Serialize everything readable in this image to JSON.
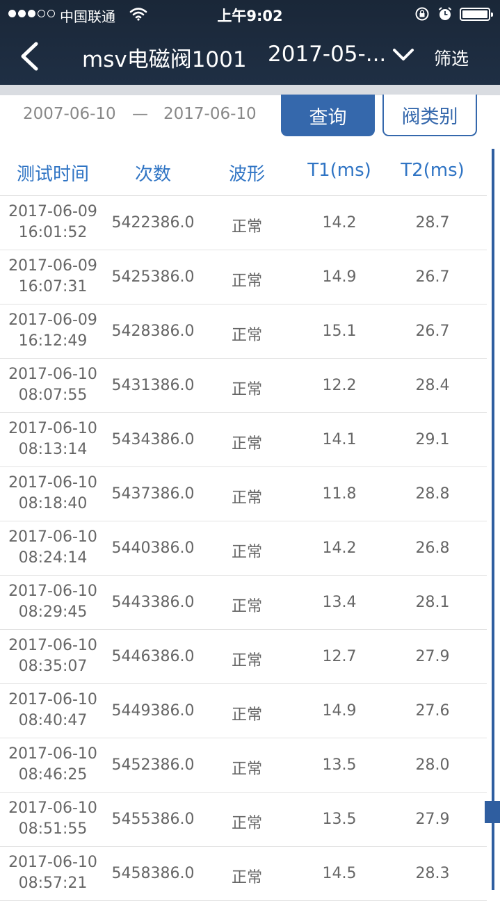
{
  "status_bar": {
    "carrier": "中国联通",
    "time": "上午9:02",
    "icons": [
      "signal-icon",
      "wifi-icon",
      "lock-rotation-icon",
      "alarm-icon",
      "battery-icon"
    ]
  },
  "header": {
    "title": "msv电磁阀1001",
    "date_select": "2017-05-...",
    "filter_label": "筛选"
  },
  "query": {
    "start_date": "2007-06-10",
    "separator": "—",
    "end_date": "2017-06-10",
    "query_button": "查询",
    "category_button": "阀类别"
  },
  "table": {
    "columns": [
      "测试时间",
      "次数",
      "波形",
      "T1(ms)",
      "T2(ms)"
    ],
    "rows": [
      {
        "date": "2017-06-09",
        "time": "16:01:52",
        "count": "5422386.0",
        "wave": "正常",
        "t1": "14.2",
        "t2": "28.7"
      },
      {
        "date": "2017-06-09",
        "time": "16:07:31",
        "count": "5425386.0",
        "wave": "正常",
        "t1": "14.9",
        "t2": "26.7"
      },
      {
        "date": "2017-06-09",
        "time": "16:12:49",
        "count": "5428386.0",
        "wave": "正常",
        "t1": "15.1",
        "t2": "26.7"
      },
      {
        "date": "2017-06-10",
        "time": "08:07:55",
        "count": "5431386.0",
        "wave": "正常",
        "t1": "12.2",
        "t2": "28.4"
      },
      {
        "date": "2017-06-10",
        "time": "08:13:14",
        "count": "5434386.0",
        "wave": "正常",
        "t1": "14.1",
        "t2": "29.1"
      },
      {
        "date": "2017-06-10",
        "time": "08:18:40",
        "count": "5437386.0",
        "wave": "正常",
        "t1": "11.8",
        "t2": "28.8"
      },
      {
        "date": "2017-06-10",
        "time": "08:24:14",
        "count": "5440386.0",
        "wave": "正常",
        "t1": "14.2",
        "t2": "26.8"
      },
      {
        "date": "2017-06-10",
        "time": "08:29:45",
        "count": "5443386.0",
        "wave": "正常",
        "t1": "13.4",
        "t2": "28.1"
      },
      {
        "date": "2017-06-10",
        "time": "08:35:07",
        "count": "5446386.0",
        "wave": "正常",
        "t1": "12.7",
        "t2": "27.9"
      },
      {
        "date": "2017-06-10",
        "time": "08:40:47",
        "count": "5449386.0",
        "wave": "正常",
        "t1": "14.9",
        "t2": "27.6"
      },
      {
        "date": "2017-06-10",
        "time": "08:46:25",
        "count": "5452386.0",
        "wave": "正常",
        "t1": "13.5",
        "t2": "28.0"
      },
      {
        "date": "2017-06-10",
        "time": "08:51:55",
        "count": "5455386.0",
        "wave": "正常",
        "t1": "13.5",
        "t2": "27.9"
      },
      {
        "date": "2017-06-10",
        "time": "08:57:21",
        "count": "5458386.0",
        "wave": "正常",
        "t1": "14.5",
        "t2": "28.3"
      }
    ]
  },
  "colors": {
    "header_bg": "#1f2f44",
    "accent": "#3568ac",
    "column_header": "#2f74c4",
    "cell_text": "#666666"
  }
}
